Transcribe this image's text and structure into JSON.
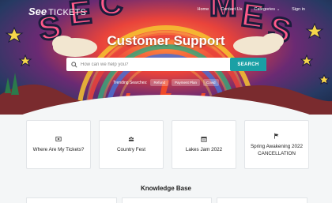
{
  "brand": {
    "see": "See",
    "tickets": "TICKETS"
  },
  "nav": {
    "home": "Home",
    "contact": "Contact Us",
    "categories": "Categories",
    "signin": "Sign in"
  },
  "hero": {
    "title": "Customer Support",
    "search_placeholder": "How can we help you?",
    "search_button": "SEARCH",
    "trending_label": "Trending Searches:",
    "trending": [
      "Refund",
      "Payment Plan",
      "Covid"
    ]
  },
  "cards": [
    {
      "label": "Where Are My Tickets?",
      "icon": "ticket-icon"
    },
    {
      "label": "Country Fest",
      "icon": "crowd-icon"
    },
    {
      "label": "Lakes Jam 2022",
      "icon": "calendar-icon"
    },
    {
      "label": "Spring Awakening 2022 CANCELLATION",
      "icon": "flag-icon"
    }
  ],
  "knowledge_base": {
    "title": "Knowledge Base"
  },
  "colors": {
    "accent": "#1aa0a5",
    "background": "#f4f6f7"
  }
}
